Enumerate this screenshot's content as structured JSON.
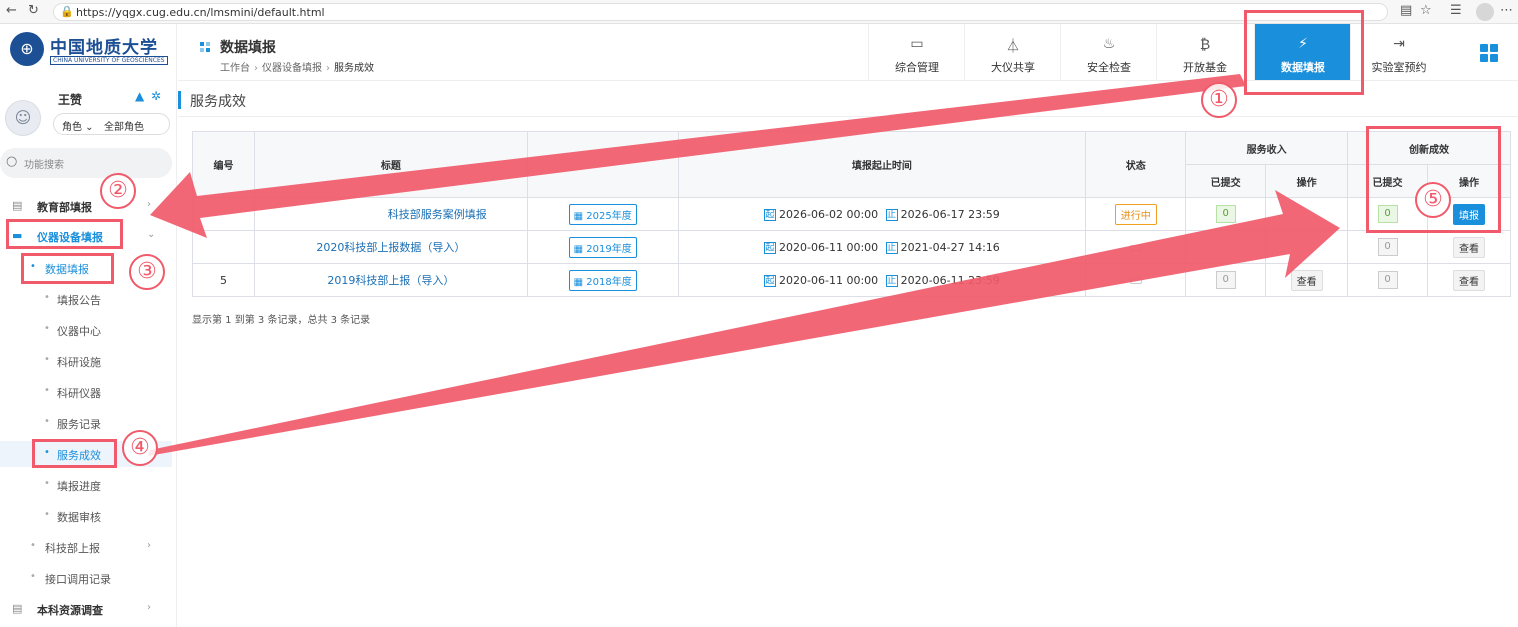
{
  "browser": {
    "url": "https://yqgx.cug.edu.cn/lmsmini/default.html"
  },
  "logo": {
    "cn": "中国地质大学",
    "en": "CHINA UNIVERSITY OF GEOSCIENCES"
  },
  "user": {
    "name": "王赞",
    "role_label": "角色",
    "role_value": "全部角色"
  },
  "search": {
    "placeholder": "功能搜索"
  },
  "sidebar": {
    "items": [
      {
        "label": "教育部填报"
      },
      {
        "label": "仪器设备填报"
      },
      {
        "label": "数据填报"
      },
      {
        "label": "填报公告"
      },
      {
        "label": "仪器中心"
      },
      {
        "label": "科研设施"
      },
      {
        "label": "科研仪器"
      },
      {
        "label": "服务记录"
      },
      {
        "label": "服务成效"
      },
      {
        "label": "填报进度"
      },
      {
        "label": "数据审核"
      },
      {
        "label": "科技部上报"
      },
      {
        "label": "接口调用记录"
      },
      {
        "label": "本科资源调查"
      }
    ]
  },
  "header": {
    "title": "数据填报",
    "breadcrumb": [
      "工作台",
      "仪器设备填报",
      "服务成效"
    ]
  },
  "topnav": [
    {
      "label": "综合管理",
      "icon": "laptop-icon"
    },
    {
      "label": "大仪共享",
      "icon": "flask-icon"
    },
    {
      "label": "安全检查",
      "icon": "fire-icon"
    },
    {
      "label": "开放基金",
      "icon": "bitcoin-icon"
    },
    {
      "label": "数据填报",
      "icon": "magic-wand-icon"
    },
    {
      "label": "实验室预约",
      "icon": "sign-in-icon"
    }
  ],
  "section": {
    "title": "服务成效"
  },
  "table": {
    "headers": {
      "id": "编号",
      "title": "标题",
      "time": "填报起止时间",
      "status": "状态",
      "service_income": "服务收入",
      "innovation": "创新成效",
      "submitted": "已提交",
      "action": "操作"
    },
    "rows": [
      {
        "id": "",
        "title": "科技部服务案例填报",
        "year": "2025年度",
        "start_tag": "起",
        "start": "2026-06-02 00:00",
        "end_tag": "止",
        "end": "2026-06-17 23:59",
        "status": "进行中",
        "si_count": "0",
        "si_action": "",
        "in_count": "0",
        "in_action": "填报"
      },
      {
        "id": "",
        "title": "2020科技部上报数据（导入）",
        "year": "2019年度",
        "start_tag": "起",
        "start": "2020-06-11 00:00",
        "end_tag": "止",
        "end": "2021-04-27 14:16",
        "status": "",
        "si_count": "",
        "si_action": "",
        "in_count": "0",
        "in_action": "查看"
      },
      {
        "id": "5",
        "title": "2019科技部上报（导入）",
        "year": "2018年度",
        "start_tag": "起",
        "start": "2020-06-11 00:00",
        "end_tag": "止",
        "end": "2020-06-11 23:59",
        "status": "",
        "si_count": "0",
        "si_action": "查看",
        "in_count": "0",
        "in_action": "查看"
      }
    ],
    "footer": "显示第 1 到第 3 条记录，总共 3 条记录"
  },
  "annotations": [
    "①",
    "②",
    "③",
    "④",
    "⑤"
  ],
  "colors": {
    "accent": "#1a8fdc",
    "annotation": "#f05a6a"
  }
}
